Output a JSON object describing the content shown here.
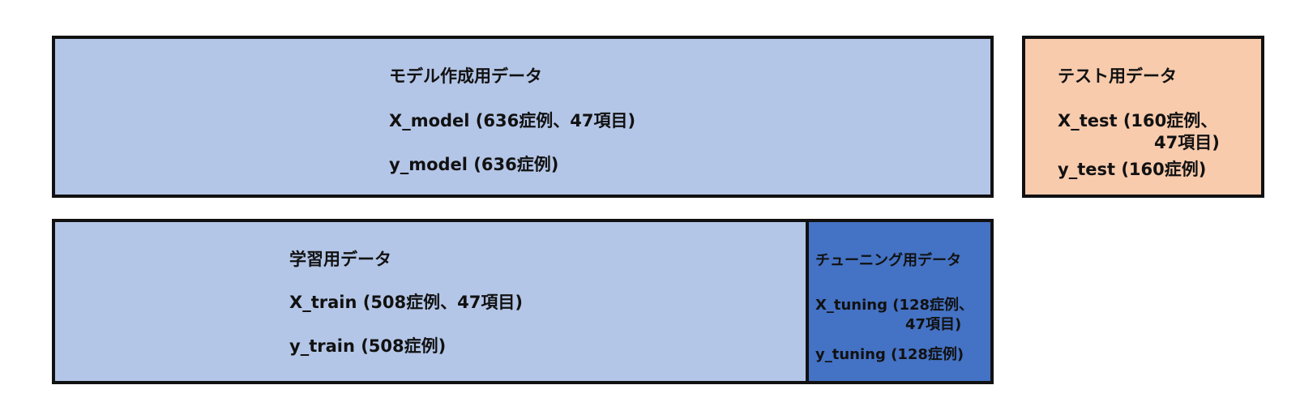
{
  "colors": {
    "light_blue": "#b4c6e7",
    "peach": "#f8cbad",
    "mid_blue": "#4472c4",
    "border": "#111111"
  },
  "model_block": {
    "title": "モデル作成用データ",
    "x_line": "X_model (636症例、47項目)",
    "y_line": "y_model (636症例)"
  },
  "test_block": {
    "title": "テスト用データ",
    "x_line_1": "X_test (160症例、",
    "x_line_2": "47項目)",
    "y_line": "y_test (160症例)"
  },
  "train_block": {
    "title": "学習用データ",
    "x_line": "X_train (508症例、47項目)",
    "y_line": "y_train (508症例)"
  },
  "tuning_block": {
    "title": "チューニング用データ",
    "x_line_1": "X_tuning (128症例、",
    "x_line_2": "47項目)",
    "y_line": "y_tuning (128症例)"
  }
}
